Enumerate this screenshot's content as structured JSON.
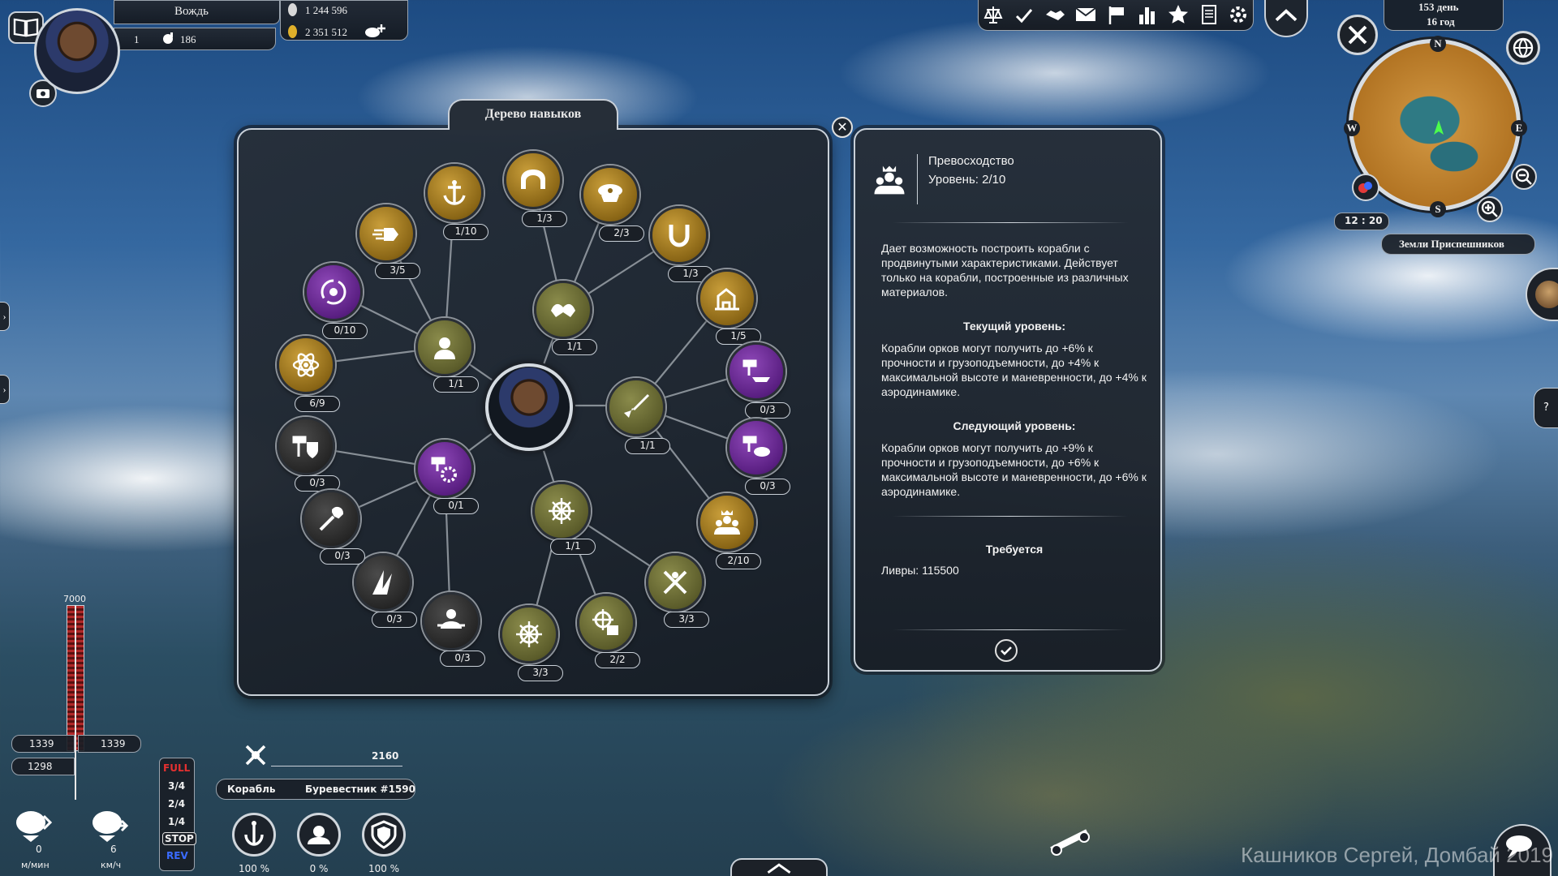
{
  "player": {
    "rank": "Вождь",
    "level": "1",
    "crew": "186",
    "money": "1 244 596",
    "gold": "2 351 512"
  },
  "top_toolbar": {
    "icons": [
      "scales-icon",
      "check-flag-icon",
      "handshake-icon",
      "mail-icon",
      "flag-icon",
      "chart-icon",
      "star-icon",
      "notebook-icon",
      "settings-icon",
      "collapse-up-icon"
    ]
  },
  "minimap": {
    "day": "153 день",
    "year": "16 год",
    "time": "12 : 20",
    "region": "Земли Приспешников",
    "compass": {
      "n": "N",
      "e": "E",
      "s": "S",
      "w": "W"
    }
  },
  "skill_tree": {
    "title": "Дерево навыков",
    "nodes": [
      {
        "id": "anchor",
        "progress": "1/10"
      },
      {
        "id": "arch",
        "progress": "1/3"
      },
      {
        "id": "cap",
        "progress": "2/3"
      },
      {
        "id": "horseshoe",
        "progress": "1/3"
      },
      {
        "id": "harbor",
        "progress": "1/5"
      },
      {
        "id": "speed",
        "progress": "3/5"
      },
      {
        "id": "atom-cycle",
        "progress": "0/10"
      },
      {
        "id": "atom",
        "progress": "6/9"
      },
      {
        "id": "officer",
        "progress": "1/1"
      },
      {
        "id": "handshake-crew",
        "progress": "1/1"
      },
      {
        "id": "hammer-shield",
        "progress": "0/3"
      },
      {
        "id": "hammer-gear",
        "progress": "0/1"
      },
      {
        "id": "helm",
        "progress": "1/1"
      },
      {
        "id": "broom",
        "progress": "1/1"
      },
      {
        "id": "hammer-ship",
        "progress": "0/3"
      },
      {
        "id": "hammer-balloon",
        "progress": "0/3"
      },
      {
        "id": "crown-crew",
        "progress": "2/10"
      },
      {
        "id": "crossed-blades",
        "progress": "3/3"
      },
      {
        "id": "helm-engine",
        "progress": "2/2"
      },
      {
        "id": "helm-small",
        "progress": "3/3"
      },
      {
        "id": "mechanic",
        "progress": "0/3"
      },
      {
        "id": "wings",
        "progress": "0/3"
      },
      {
        "id": "wrench",
        "progress": "0/3"
      }
    ]
  },
  "info": {
    "name": "Превосходство",
    "level": "Уровень: 2/10",
    "description": "Дает возможность построить корабли с продвинутыми характеристиками. Действует только на корабли, построенные из различных материалов.",
    "current_title": "Текущий уровень:",
    "current_text": "Корабли орков могут получить до +6% к прочности и грузоподъемности, до +4% к максимальной высоте и маневренности, до +4% к аэродинамике.",
    "next_title": "Следующий уровень:",
    "next_text": "Корабли орков могут получить до +9% к прочности и грузоподъемности, до +6% к максимальной высоте и маневренности, до +6% к аэродинамике.",
    "requires_title": "Требуется",
    "requires_text": "Ливры: 115500"
  },
  "altitude": {
    "max": "7000",
    "left": "1339",
    "right": "1339",
    "current": "1298"
  },
  "throttle": {
    "levels": [
      "FULL",
      "3/4",
      "2/4",
      "1/4",
      "STOP",
      "REV"
    ],
    "colors": {
      "full": "#e53030",
      "stop": "#f0f0f0",
      "rev": "#3a6bff"
    }
  },
  "speed": {
    "climb_value": "0",
    "climb_unit": "м/мин",
    "speed_value": "6",
    "speed_unit": "км/ч"
  },
  "ship": {
    "power": "2160",
    "label": "Корабль",
    "name": "Буревестник #1590",
    "gauges": [
      "100 %",
      "0 %",
      "100 %"
    ]
  },
  "watermark": "Кашников Сергей, Домбай 2019"
}
